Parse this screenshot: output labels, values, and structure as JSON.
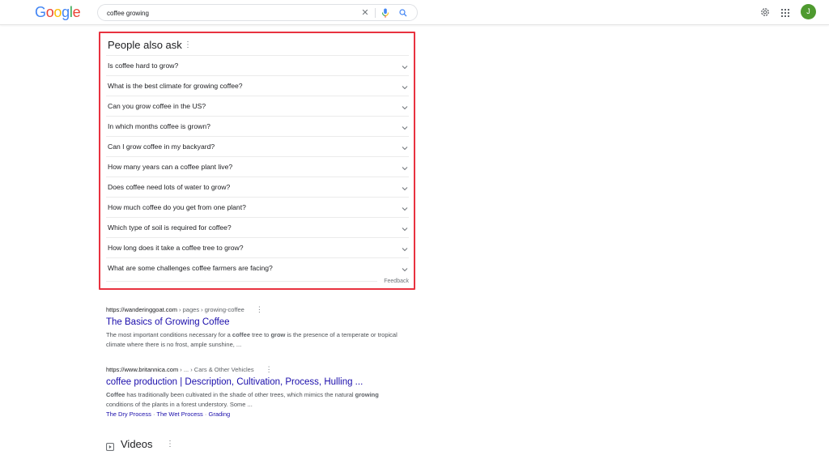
{
  "header": {
    "logo_letters": [
      {
        "char": "G",
        "color": "#4285f4"
      },
      {
        "char": "o",
        "color": "#ea4335"
      },
      {
        "char": "o",
        "color": "#fbbc05"
      },
      {
        "char": "g",
        "color": "#4285f4"
      },
      {
        "char": "l",
        "color": "#34a853"
      },
      {
        "char": "e",
        "color": "#ea4335"
      }
    ],
    "search_query": "coffee growing",
    "icons": {
      "clear": "close-icon",
      "mic": "microphone-icon",
      "search": "search-icon",
      "settings": "gear-icon",
      "apps": "apps-grid-icon"
    },
    "avatar_initial": "J",
    "avatar_color": "#4e9a2f"
  },
  "people_also_ask": {
    "title": "People also ask",
    "highlight_color": "#e8323f",
    "questions": [
      "Is coffee hard to grow?",
      "What is the best climate for growing coffee?",
      "Can you grow coffee in the US?",
      "In which months coffee is grown?",
      "Can I grow coffee in my backyard?",
      "How many years can a coffee plant live?",
      "Does coffee need lots of water to grow?",
      "How much coffee do you get from one plant?",
      "Which type of soil is required for coffee?",
      "How long does it take a coffee tree to grow?",
      "What are some challenges coffee farmers are facing?"
    ],
    "feedback_label": "Feedback"
  },
  "results": [
    {
      "domain": "https://wanderinggoat.com",
      "path": " › pages › growing-coffee",
      "title": "The Basics of Growing Coffee",
      "snippet_parts": [
        {
          "text": "The most important conditions necessary for a ",
          "bold": false
        },
        {
          "text": "coffee",
          "bold": true
        },
        {
          "text": " tree to ",
          "bold": false
        },
        {
          "text": "grow",
          "bold": true
        },
        {
          "text": " is the presence of a temperate or tropical climate where there is no frost, ample sunshine, ...",
          "bold": false
        }
      ]
    },
    {
      "domain": "https://www.britannica.com",
      "path": " › ... › Cars & Other Vehicles",
      "title": "coffee production | Description, Cultivation, Process, Hulling ...",
      "snippet_parts": [
        {
          "text": "Coffee",
          "bold": true
        },
        {
          "text": " has traditionally been cultivated in the shade of other trees, which mimics the natural ",
          "bold": false
        },
        {
          "text": "growing",
          "bold": true
        },
        {
          "text": " conditions of the plants in a forest understory. Some ...",
          "bold": false
        }
      ],
      "sitelinks": [
        "The Dry Process",
        "The Wet Process",
        "Grading"
      ]
    }
  ],
  "videos_section": {
    "title": "Videos"
  }
}
